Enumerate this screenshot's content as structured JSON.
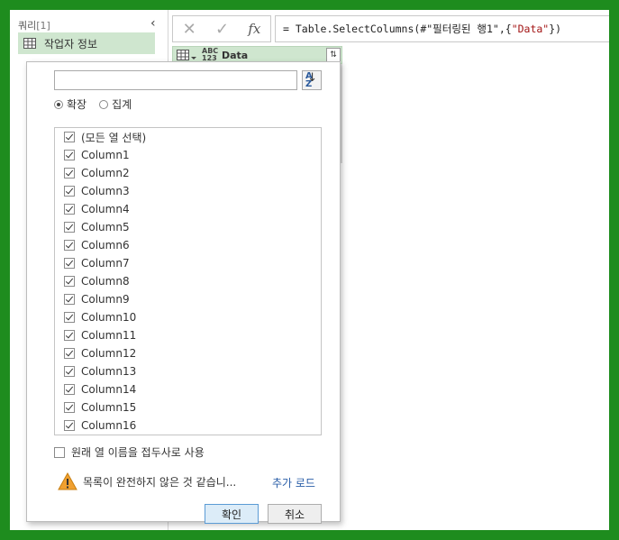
{
  "query_pane": {
    "header": "쿼리",
    "count": "[1]",
    "collapse_glyph": "‹",
    "item_label": "작업자 정보"
  },
  "formula_bar": {
    "cancel_glyph": "✕",
    "confirm_glyph": "✓",
    "fx_label": "fx",
    "prefix": "= Table.SelectColumns(#\"필터링된 행1\",{",
    "string": "\"Data\"",
    "suffix": "})"
  },
  "column_header": {
    "type_top": "ABC",
    "type_bottom": "123",
    "name": "Data",
    "expand_glyph": "⇅"
  },
  "popup": {
    "search_placeholder": "",
    "sort_label_top": "A",
    "sort_label_bottom": "Z",
    "sort_arrow": "↓",
    "radio_expand": "확장",
    "radio_aggregate": "집계",
    "columns": [
      "(모든 열 선택)",
      "Column1",
      "Column2",
      "Column3",
      "Column4",
      "Column5",
      "Column6",
      "Column7",
      "Column8",
      "Column9",
      "Column10",
      "Column11",
      "Column12",
      "Column13",
      "Column14",
      "Column15",
      "Column16"
    ],
    "prefix_label": "원래 열 이름을 접두사로 사용",
    "warning_text": "목록이 완전하지 않은 것 같습니...",
    "load_more": "추가 로드",
    "ok": "확인",
    "cancel": "취소"
  },
  "colors": {
    "frame": "#1e8c1e",
    "selection": "#cfe6cf",
    "link": "#2a5ea8",
    "warning": "#f0a030"
  }
}
